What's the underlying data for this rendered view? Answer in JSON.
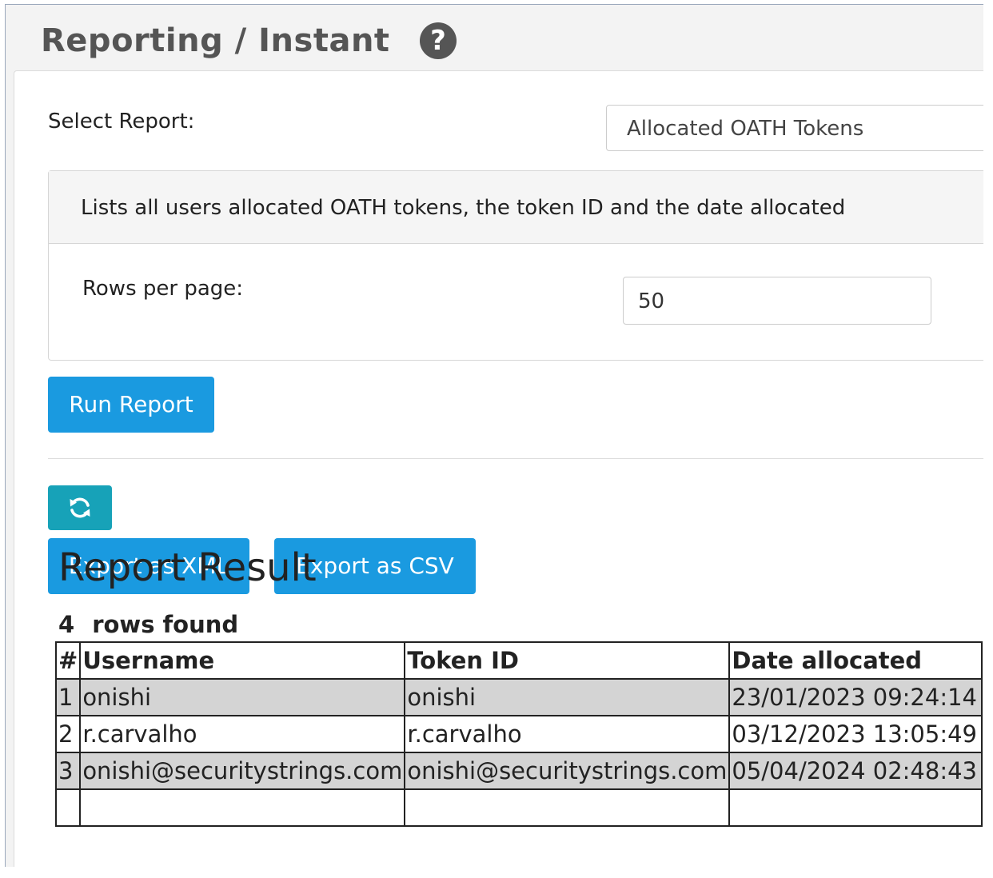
{
  "header": {
    "title": "Reporting / Instant",
    "help_icon": "?"
  },
  "form": {
    "select_report_label": "Select Report:",
    "selected_report": "Allocated OATH Tokens",
    "description": "Lists all users allocated OATH tokens, the token ID and the date allocated",
    "rows_per_page_label": "Rows per page:",
    "rows_per_page_value": "50",
    "run_button": "Run Report"
  },
  "actions": {
    "refresh_icon": "refresh-icon",
    "export_xml": "Export as XML",
    "export_csv": "Export as CSV"
  },
  "result": {
    "title": "Report Result",
    "row_count": "4",
    "rows_found_label": "rows found",
    "columns": [
      "#",
      "Username",
      "Token ID",
      "Date allocated"
    ],
    "rows": [
      [
        "1",
        "onishi",
        "onishi",
        "23/01/2023 09:24:14"
      ],
      [
        "2",
        "r.carvalho",
        "r.carvalho",
        "03/12/2023 13:05:49"
      ],
      [
        "3",
        "onishi@securitystrings.com",
        "onishi@securitystrings.com",
        "05/04/2024 02:48:43"
      ]
    ]
  },
  "colors": {
    "primary": "#1a9ae0",
    "info": "#17a2b8",
    "row_shade": "#d4d4d4"
  }
}
